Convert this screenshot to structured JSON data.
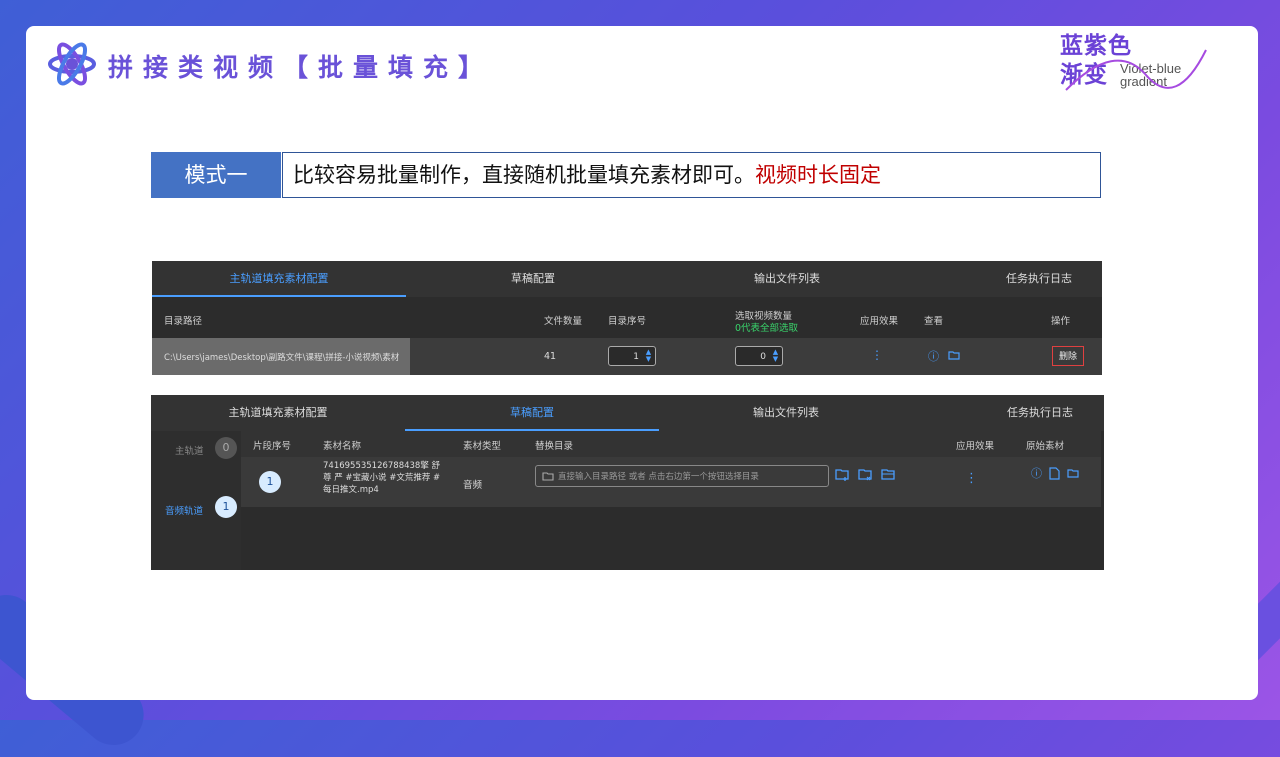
{
  "slide": {
    "title": "拼接类视频【批量填充】",
    "brand_cn_line1": "蓝紫色",
    "brand_cn_line2": "渐变",
    "brand_en_line1": "Violet-blue",
    "brand_en_line2": "gradient"
  },
  "mode": {
    "label": "模式一",
    "desc": "比较容易批量制作，直接随机批量填充素材即可。",
    "desc_red": "视频时长固定"
  },
  "panel1": {
    "tabs": [
      "主轨道填充素材配置",
      "草稿配置",
      "输出文件列表",
      "任务执行日志"
    ],
    "active_tab": 0,
    "headers": {
      "path": "目录路径",
      "count": "文件数量",
      "index": "目录序号",
      "pick": "选取视频数量",
      "pick_note": "0代表全部选取",
      "effect": "应用效果",
      "view": "查看",
      "action": "操作"
    },
    "row": {
      "path": "C:\\Users\\james\\Desktop\\副路文件\\课程\\拼接-小说视频\\素材",
      "count": "41",
      "index": "1",
      "pick": "0",
      "delete": "删除"
    }
  },
  "panel2": {
    "tabs": [
      "主轨道填充素材配置",
      "草稿配置",
      "输出文件列表",
      "任务执行日志"
    ],
    "active_tab": 1,
    "sidebar": [
      {
        "label": "主轨道",
        "badge": "0"
      },
      {
        "label": "音频轨道",
        "badge": "1"
      }
    ],
    "headers": {
      "seg": "片段序号",
      "name": "素材名称",
      "type": "素材类型",
      "replace": "替换目录",
      "effect": "应用效果",
      "original": "原始素材"
    },
    "row": {
      "seg": "1",
      "name_line1": "741695535126788438擎 舒",
      "name_line2": "尊 严 #宝藏小说 #文荒推荐 #",
      "name_line3": "每日推文.mp4",
      "type": "音频",
      "placeholder": "直接输入目录路径  或者  点击右边第一个按钮选择目录"
    }
  }
}
